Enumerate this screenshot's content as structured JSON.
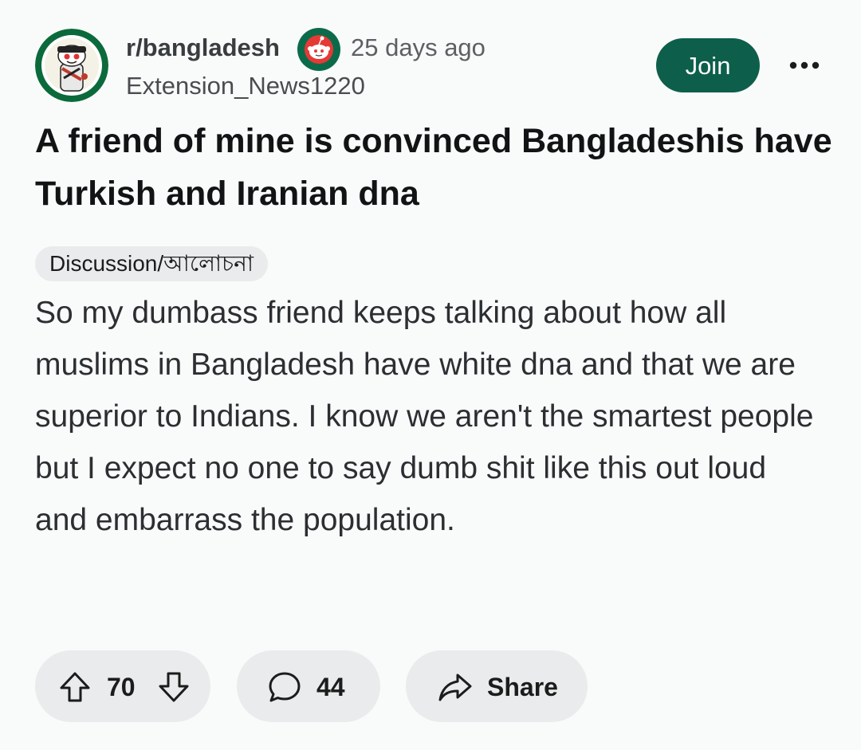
{
  "post": {
    "subreddit": "r/bangladesh",
    "time_ago": "25 days ago",
    "author": "Extension_News1220",
    "join_label": "Join",
    "title": "A friend of mine is convinced Bangladeshis have Turkish and Iranian dna",
    "flair": "Discussion/আলোচনা",
    "body": "So my dumbass friend keeps talking about how all muslims in Bangladesh have white dna and that we are superior to Indians. I know we aren't the smartest people but I expect no one to say dumb shit like this out loud and embarrass the population."
  },
  "actions": {
    "votes": "70",
    "comments": "44",
    "share_label": "Share"
  },
  "icons": {
    "avatar": "subreddit-avatar-icon",
    "badge": "reddit-snoo-badge-icon",
    "more": "more-options-icon",
    "upvote": "upvote-arrow-icon",
    "downvote": "downvote-arrow-icon",
    "comment": "comment-bubble-icon",
    "share": "share-arrow-icon"
  },
  "colors": {
    "join_background": "#0d5f4b",
    "pill_background": "#e9ebec",
    "page_background": "#f9fafa"
  }
}
